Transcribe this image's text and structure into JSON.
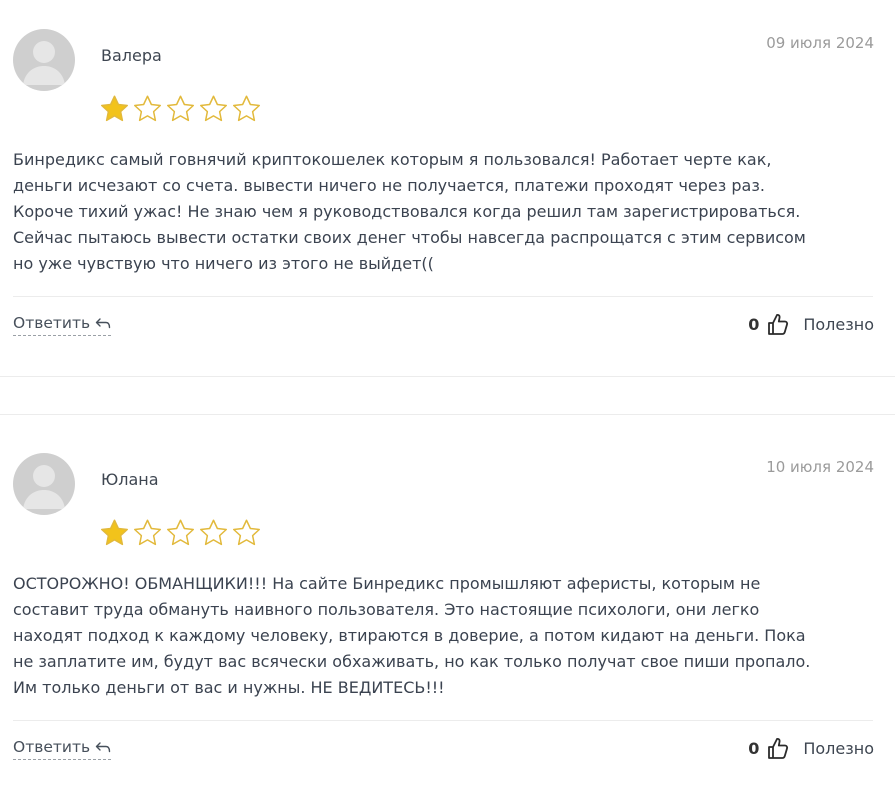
{
  "colors": {
    "star_filled": "#f2c31b",
    "star_empty_stroke": "#e2b93b",
    "text": "#3b4350",
    "date": "#9b9b9b"
  },
  "reviews": [
    {
      "author": "Валера",
      "date": "09 июля 2024",
      "rating": 1,
      "rating_max": 5,
      "text_lines": [
        "Бинредикс самый говнячий криптокошелек которым я пользовался! Работает черте как,",
        "деньги исчезают со счета. вывести ничего не получается, платежи проходят через раз.",
        "Короче тихий ужас! Не знаю чем я руководствовался когда решил там зарегистрироваться.",
        "Сейчас пытаюсь вывести остатки своих денег чтобы навсегда распрощатся с этим сервисом",
        "но уже чувствую что ничего из этого не выйдет(("
      ],
      "reply_label": "Ответить",
      "helpful_count": "0",
      "helpful_label": "Полезно",
      "icons": {
        "reply": "reply-arrow-icon",
        "helpful": "thumbs-up-icon"
      }
    },
    {
      "author": "Юлана",
      "date": "10 июля 2024",
      "rating": 1,
      "rating_max": 5,
      "text_lines": [
        "ОСТОРОЖНО! ОБМАНЩИКИ!!! На сайте Бинредикс промышляют аферисты, которым не",
        "составит труда обмануть наивного пользователя. Это настоящие психологи, они легко",
        "находят подход к каждому человеку, втираются в доверие, а потом кидают на деньги. Пока",
        "не заплатите им, будут вас всячески обхаживать, но как только получат свое пиши пропало.",
        "Им только деньги от вас и нужны. НЕ ВЕДИТЕСЬ!!!"
      ],
      "reply_label": "Ответить",
      "helpful_count": "0",
      "helpful_label": "Полезно",
      "icons": {
        "reply": "reply-arrow-icon",
        "helpful": "thumbs-up-icon"
      }
    }
  ]
}
